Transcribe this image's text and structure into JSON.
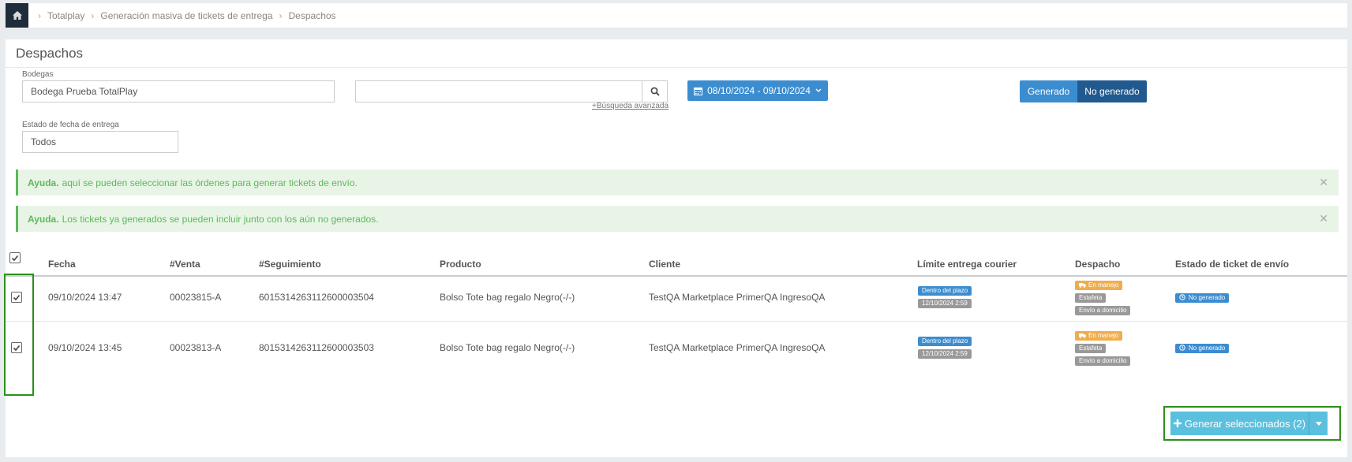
{
  "breadcrumb": {
    "items": [
      "Totalplay",
      "Generación masiva de tickets de entrega",
      "Despachos"
    ]
  },
  "page_title": "Despachos",
  "filters": {
    "bodegas_label": "Bodegas",
    "bodegas_value": "Bodega Prueba TotalPlay",
    "search_value": "",
    "advanced_search": "+Búsqueda avanzada",
    "date_range": "08/10/2024 - 09/10/2024",
    "toggle_on": "Generado",
    "toggle_off": "No generado",
    "estado_label": "Estado de fecha de entrega",
    "estado_value": "Todos"
  },
  "alerts": [
    {
      "title": "Ayuda.",
      "text": "aquí se pueden seleccionar las órdenes para generar tickets de envío."
    },
    {
      "title": "Ayuda.",
      "text": "Los tickets ya generados se pueden incluir junto con los aún no generados."
    }
  ],
  "table": {
    "headers": [
      "Fecha",
      "#Venta",
      "#Seguimiento",
      "Producto",
      "Cliente",
      "Límite entrega courier",
      "Despacho",
      "Estado de ticket de envío"
    ],
    "rows": [
      {
        "fecha": "09/10/2024 13:47",
        "venta": "00023815-A",
        "seguimiento": "6015314263112600003504",
        "producto": "Bolso Tote bag regalo Negro(-/-)",
        "cliente": "TestQA Marketplace PrimerQA IngresoQA",
        "limite_status": "Dentro del plazo",
        "limite_date": "12/10/2024 2:59",
        "despacho_status": "En manejo",
        "despacho_carrier": "Estafeta",
        "despacho_tipo": "Envío a domicilio",
        "ticket_estado": "No generado"
      },
      {
        "fecha": "09/10/2024 13:45",
        "venta": "00023813-A",
        "seguimiento": "8015314263112600003503",
        "producto": "Bolso Tote bag regalo Negro(-/-)",
        "cliente": "TestQA Marketplace PrimerQA IngresoQA",
        "limite_status": "Dentro del plazo",
        "limite_date": "12/10/2024 2:59",
        "despacho_status": "En manejo",
        "despacho_carrier": "Estafeta",
        "despacho_tipo": "Envío a domicilio",
        "ticket_estado": "No generado"
      }
    ]
  },
  "generate_button": "Generar seleccionados (2)",
  "icons": {
    "home": "home-icon",
    "search": "search-icon",
    "calendar": "calendar-icon",
    "truck": "truck-icon",
    "clock": "clock-icon",
    "plus": "plus-icon",
    "caret": "caret-down-icon",
    "close": "close-icon",
    "check": "checkbox-checked-icon"
  },
  "colors": {
    "primary": "#3c8dd0",
    "dark_primary": "#215a8e",
    "info": "#5bc0de",
    "success": "#5cb85c",
    "warning": "#f0ad4e",
    "highlight": "#2d8f1c"
  }
}
